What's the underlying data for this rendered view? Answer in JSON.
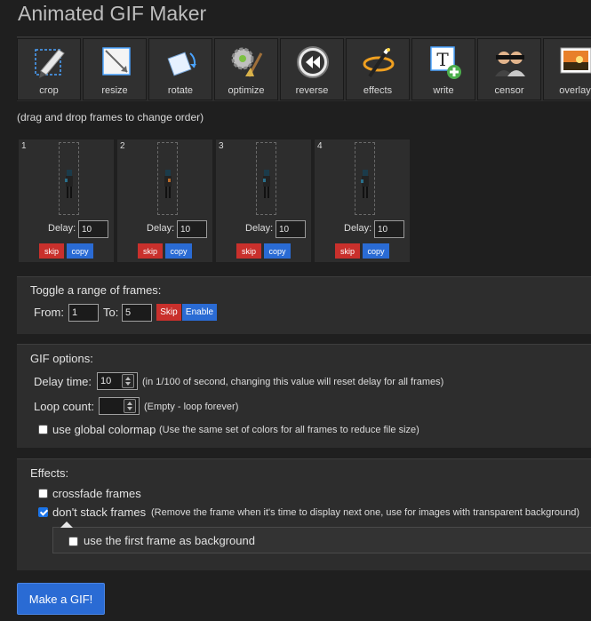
{
  "app": {
    "title": "Animated GIF Maker"
  },
  "toolbar": {
    "tools": [
      {
        "label": "crop",
        "icon": "crop-icon"
      },
      {
        "label": "resize",
        "icon": "resize-icon"
      },
      {
        "label": "rotate",
        "icon": "rotate-icon"
      },
      {
        "label": "optimize",
        "icon": "optimize-icon"
      },
      {
        "label": "reverse",
        "icon": "reverse-icon"
      },
      {
        "label": "effects",
        "icon": "effects-icon"
      },
      {
        "label": "write",
        "icon": "write-icon"
      },
      {
        "label": "censor",
        "icon": "censor-icon"
      },
      {
        "label": "overlay",
        "icon": "overlay-icon"
      }
    ]
  },
  "frames_hint": "(drag and drop frames to change order)",
  "frames": [
    {
      "number": "1",
      "delay_label": "Delay:",
      "delay": "10",
      "skip_label": "skip",
      "copy_label": "copy"
    },
    {
      "number": "2",
      "delay_label": "Delay:",
      "delay": "10",
      "skip_label": "skip",
      "copy_label": "copy"
    },
    {
      "number": "3",
      "delay_label": "Delay:",
      "delay": "10",
      "skip_label": "skip",
      "copy_label": "copy"
    },
    {
      "number": "4",
      "delay_label": "Delay:",
      "delay": "10",
      "skip_label": "skip",
      "copy_label": "copy"
    }
  ],
  "toggle": {
    "title": "Toggle a range of frames:",
    "from_label": "From:",
    "from_value": "1",
    "to_label": "To:",
    "to_value": "5",
    "skip_label": "Skip",
    "enable_label": "Enable"
  },
  "gif_options": {
    "title": "GIF options:",
    "delay_label": "Delay time:",
    "delay_value": "10",
    "delay_note": "(in 1/100 of second, changing this value will reset delay for all frames)",
    "loop_label": "Loop count:",
    "loop_value": "",
    "loop_note": "(Empty - loop forever)",
    "colormap_label": "use global colormap",
    "colormap_note": "(Use the same set of colors for all frames to reduce file size)",
    "colormap_checked": false
  },
  "effects": {
    "title": "Effects:",
    "crossfade_label": "crossfade frames",
    "crossfade_checked": false,
    "nostack_label": "don't stack frames",
    "nostack_note": "(Remove the frame when it's time to display next one, use for images with transparent background)",
    "nostack_checked": true,
    "firstframe_label": "use the first frame as background",
    "firstframe_checked": false
  },
  "make_button": "Make a GIF!",
  "colors": {
    "accent_blue": "#2a6bd4",
    "danger_red": "#c9302c",
    "panel": "#2d2d2d",
    "background": "#1f1f1f"
  }
}
